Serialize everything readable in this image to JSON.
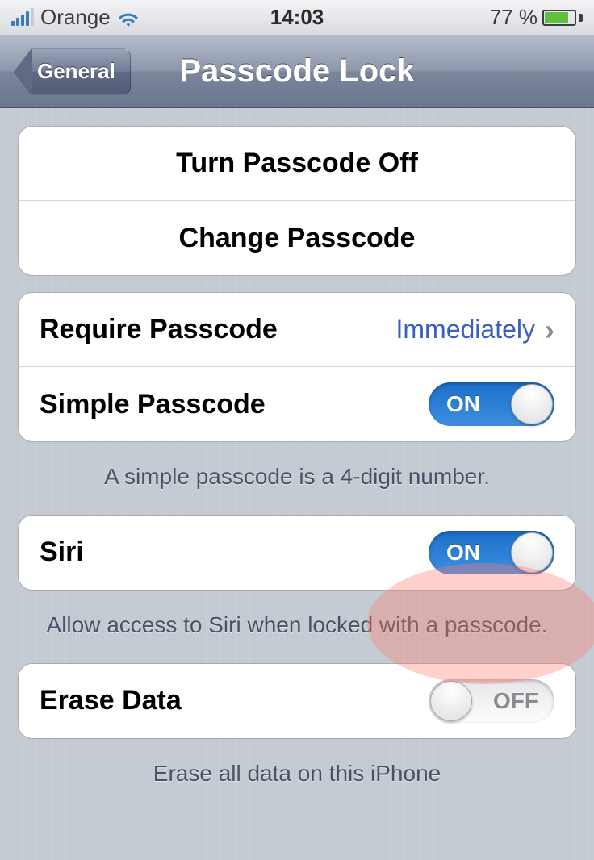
{
  "statusbar": {
    "carrier": "Orange",
    "time": "14:03",
    "battery_percent": "77 %"
  },
  "nav": {
    "back_label": "General",
    "title": "Passcode Lock"
  },
  "group1": {
    "turn_off": "Turn Passcode Off",
    "change": "Change Passcode"
  },
  "group2": {
    "require_label": "Require Passcode",
    "require_value": "Immediately",
    "simple_label": "Simple Passcode",
    "simple_toggle_text": "ON",
    "footer": "A simple passcode is a 4-digit number."
  },
  "group3": {
    "siri_label": "Siri",
    "siri_toggle_text": "ON",
    "footer": "Allow access to Siri when locked with a passcode."
  },
  "group4": {
    "erase_label": "Erase Data",
    "erase_toggle_text": "OFF",
    "footer": "Erase all data on this iPhone"
  }
}
